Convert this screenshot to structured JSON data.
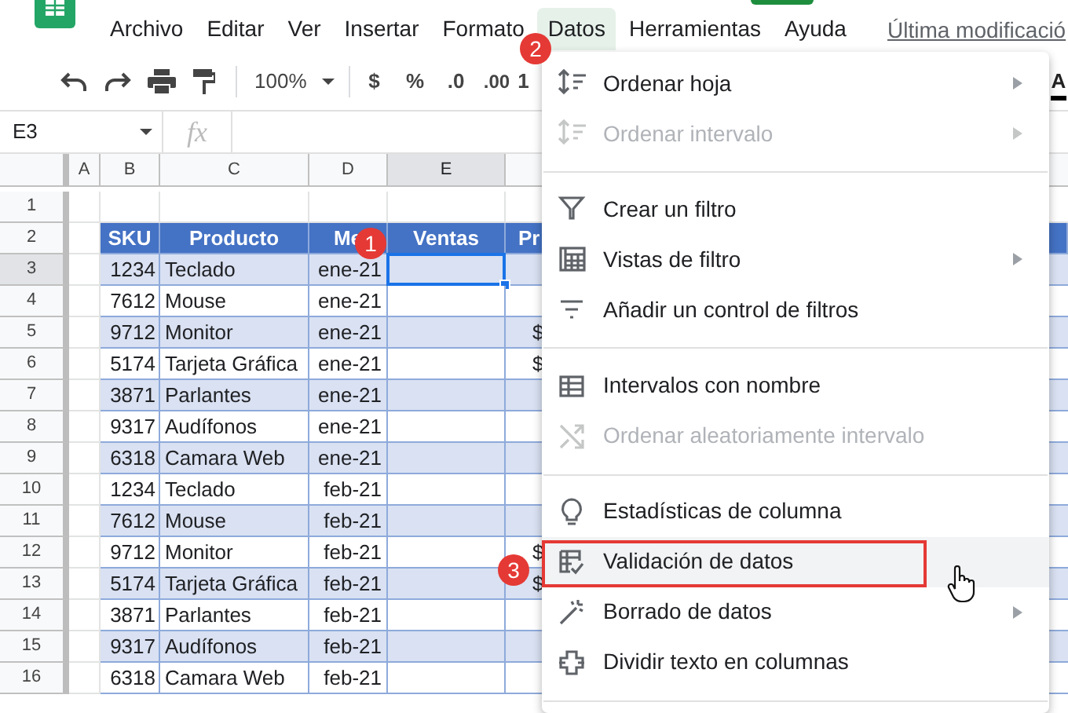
{
  "menu_bar": [
    {
      "label": "Archivo",
      "selected": false
    },
    {
      "label": "Editar",
      "selected": false
    },
    {
      "label": "Ver",
      "selected": false
    },
    {
      "label": "Insertar",
      "selected": false
    },
    {
      "label": "Formato",
      "selected": false
    },
    {
      "label": "Datos",
      "selected": true
    },
    {
      "label": "Herramientas",
      "selected": false
    },
    {
      "label": "Ayuda",
      "selected": false
    }
  ],
  "last_modified": "Última modificació",
  "toolbar": {
    "zoom": "100%",
    "currency": "$",
    "percent": "%",
    "decrease_decimals": ".0",
    "increase_decimals": ".00",
    "more_formats": "1",
    "text_color": "A"
  },
  "formula_bar": {
    "name_box": "E3",
    "fx": "fx"
  },
  "columns": [
    {
      "label": "A",
      "selected": false
    },
    {
      "label": "B",
      "selected": false
    },
    {
      "label": "C",
      "selected": false
    },
    {
      "label": "D",
      "selected": false
    },
    {
      "label": "E",
      "selected": true
    }
  ],
  "row_headers": [
    {
      "number": "1",
      "selected": false
    },
    {
      "number": "2",
      "selected": false
    },
    {
      "number": "3",
      "selected": true
    },
    {
      "number": "4",
      "selected": false
    },
    {
      "number": "5",
      "selected": false
    },
    {
      "number": "6",
      "selected": false
    },
    {
      "number": "7",
      "selected": false
    },
    {
      "number": "8",
      "selected": false
    },
    {
      "number": "9",
      "selected": false
    },
    {
      "number": "10",
      "selected": false
    },
    {
      "number": "11",
      "selected": false
    },
    {
      "number": "12",
      "selected": false
    },
    {
      "number": "13",
      "selected": false
    },
    {
      "number": "14",
      "selected": false
    },
    {
      "number": "15",
      "selected": false
    },
    {
      "number": "16",
      "selected": false
    }
  ],
  "table": {
    "headers": [
      "SKU",
      "Producto",
      "Me",
      "Ventas",
      "Pr"
    ],
    "rows": [
      {
        "sku": "1234",
        "product": "Teclado",
        "month": "ene-21",
        "active": true
      },
      {
        "sku": "7612",
        "product": "Mouse",
        "month": "ene-21",
        "active": false
      },
      {
        "sku": "9712",
        "product": "Monitor",
        "month": "ene-21",
        "active": false,
        "column_f": "$"
      },
      {
        "sku": "5174",
        "product": "Tarjeta Gráfica",
        "month": "ene-21",
        "active": false,
        "column_f": "$"
      },
      {
        "sku": "3871",
        "product": "Parlantes",
        "month": "ene-21",
        "active": false
      },
      {
        "sku": "9317",
        "product": "Audífonos",
        "month": "ene-21",
        "active": false
      },
      {
        "sku": "6318",
        "product": "Camara Web",
        "month": "ene-21",
        "active": false
      },
      {
        "sku": "1234",
        "product": "Teclado",
        "month": "feb-21",
        "active": false
      },
      {
        "sku": "7612",
        "product": "Mouse",
        "month": "feb-21",
        "active": false
      },
      {
        "sku": "9712",
        "product": "Monitor",
        "month": "feb-21",
        "active": false,
        "column_f": "$"
      },
      {
        "sku": "5174",
        "product": "Tarjeta Gráfica",
        "month": "feb-21",
        "active": false,
        "column_f": "$"
      },
      {
        "sku": "3871",
        "product": "Parlantes",
        "month": "feb-21",
        "active": false
      },
      {
        "sku": "9317",
        "product": "Audífonos",
        "month": "feb-21",
        "active": false
      },
      {
        "sku": "6318",
        "product": "Camara Web",
        "month": "feb-21",
        "active": false
      }
    ]
  },
  "data_menu": {
    "items": [
      {
        "kind": "item",
        "label": "Ordenar hoja",
        "disabled": false,
        "submenu": true,
        "highlighted": false
      },
      {
        "kind": "item",
        "label": "Ordenar intervalo",
        "disabled": true,
        "submenu": true,
        "highlighted": false
      },
      {
        "kind": "divider"
      },
      {
        "kind": "item",
        "label": "Crear un filtro",
        "disabled": false,
        "submenu": false,
        "highlighted": false
      },
      {
        "kind": "item",
        "label": "Vistas de filtro",
        "disabled": false,
        "submenu": true,
        "highlighted": false
      },
      {
        "kind": "item",
        "label": "Añadir un control de filtros",
        "disabled": false,
        "submenu": false,
        "highlighted": false
      },
      {
        "kind": "divider"
      },
      {
        "kind": "item",
        "label": "Intervalos con nombre",
        "disabled": false,
        "submenu": false,
        "highlighted": false
      },
      {
        "kind": "item",
        "label": "Ordenar aleatoriamente intervalo",
        "disabled": true,
        "submenu": false,
        "highlighted": false
      },
      {
        "kind": "divider"
      },
      {
        "kind": "item",
        "label": "Estadísticas de columna",
        "disabled": false,
        "submenu": false,
        "highlighted": false
      },
      {
        "kind": "item",
        "label": "Validación de datos",
        "disabled": false,
        "submenu": false,
        "highlighted": true
      },
      {
        "kind": "item",
        "label": "Borrado de datos",
        "disabled": false,
        "submenu": true,
        "highlighted": false
      },
      {
        "kind": "item",
        "label": "Dividir texto en columnas",
        "disabled": false,
        "submenu": false,
        "highlighted": false
      },
      {
        "kind": "divider"
      }
    ]
  },
  "callouts": [
    {
      "text": "1"
    },
    {
      "text": "2"
    },
    {
      "text": "3"
    }
  ]
}
